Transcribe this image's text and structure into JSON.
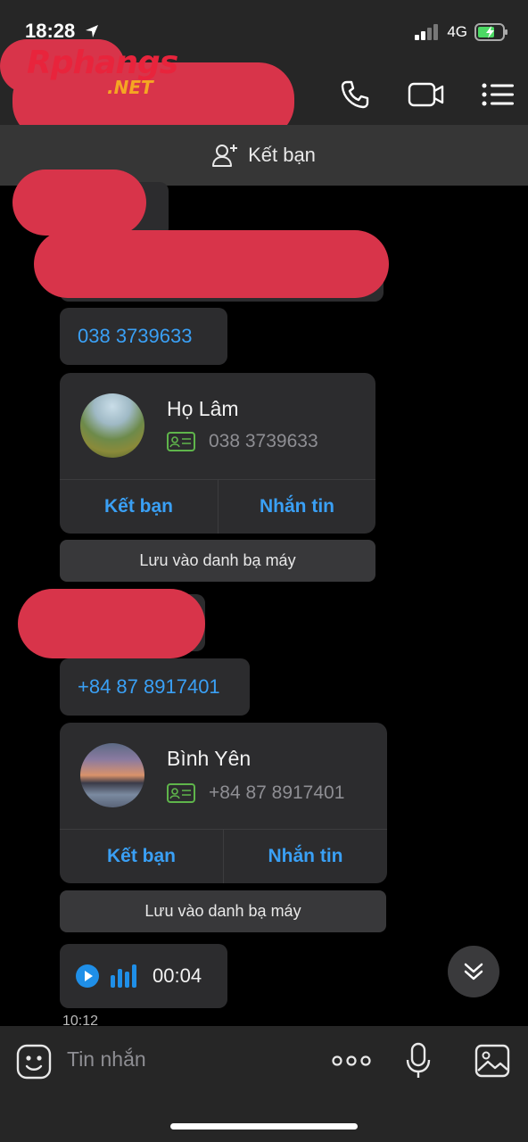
{
  "status_bar": {
    "time": "18:28",
    "network": "4G"
  },
  "watermark": {
    "logo_text": "Rphangs",
    "logo_suffix": ".NET"
  },
  "header": {
    "icons": [
      "phone-icon",
      "video-call-icon",
      "menu-list-icon"
    ]
  },
  "add_friend_bar": {
    "label": "Kết bạn"
  },
  "messages": [
    {
      "type": "phone",
      "text": "038 3739633"
    },
    {
      "type": "contact_card",
      "name": "Họ Lâm",
      "phone": "038 3739633",
      "action_add": "Kết bạn",
      "action_message": "Nhắn tin",
      "save_label": "Lưu vào danh bạ máy"
    },
    {
      "type": "phone",
      "text": "+84 87 8917401"
    },
    {
      "type": "contact_card",
      "name": "Bình Yên",
      "phone": "+84 87 8917401",
      "action_add": "Kết bạn",
      "action_message": "Nhắn tin",
      "save_label": "Lưu vào danh bạ máy"
    },
    {
      "type": "voice",
      "duration": "00:04"
    }
  ],
  "timestamp": "10:12",
  "input": {
    "placeholder": "Tin nhắn",
    "icons": [
      "emoji-icon",
      "more-icon",
      "microphone-icon",
      "image-icon"
    ]
  },
  "colors": {
    "accent": "#3aa0f5",
    "bubble": "#2c2c2e",
    "redaction": "#d8344a"
  }
}
